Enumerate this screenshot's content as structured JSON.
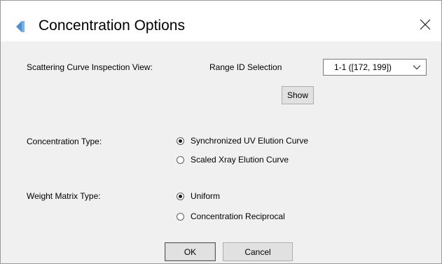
{
  "window": {
    "title": "Concentration Options",
    "close_symbol": "✕"
  },
  "inspection": {
    "label": "Scattering Curve Inspection View:",
    "range_label": "Range ID Selection",
    "range_value": "1-1 ([172, 199])",
    "show_label": "Show"
  },
  "concentration_type": {
    "label": "Concentration Type:",
    "options": [
      {
        "label": "Synchronized UV Elution Curve",
        "checked": true
      },
      {
        "label": "Scaled Xray Elution Curve",
        "checked": false
      }
    ]
  },
  "weight_matrix_type": {
    "label": "Weight Matrix Type:",
    "options": [
      {
        "label": "Uniform",
        "checked": true
      },
      {
        "label": "Concentration Reciprocal",
        "checked": false
      }
    ]
  },
  "footer": {
    "ok_label": "OK",
    "cancel_label": "Cancel"
  },
  "colors": {
    "title_icon": "#5b9bd5",
    "background": "#f0f0f0"
  }
}
